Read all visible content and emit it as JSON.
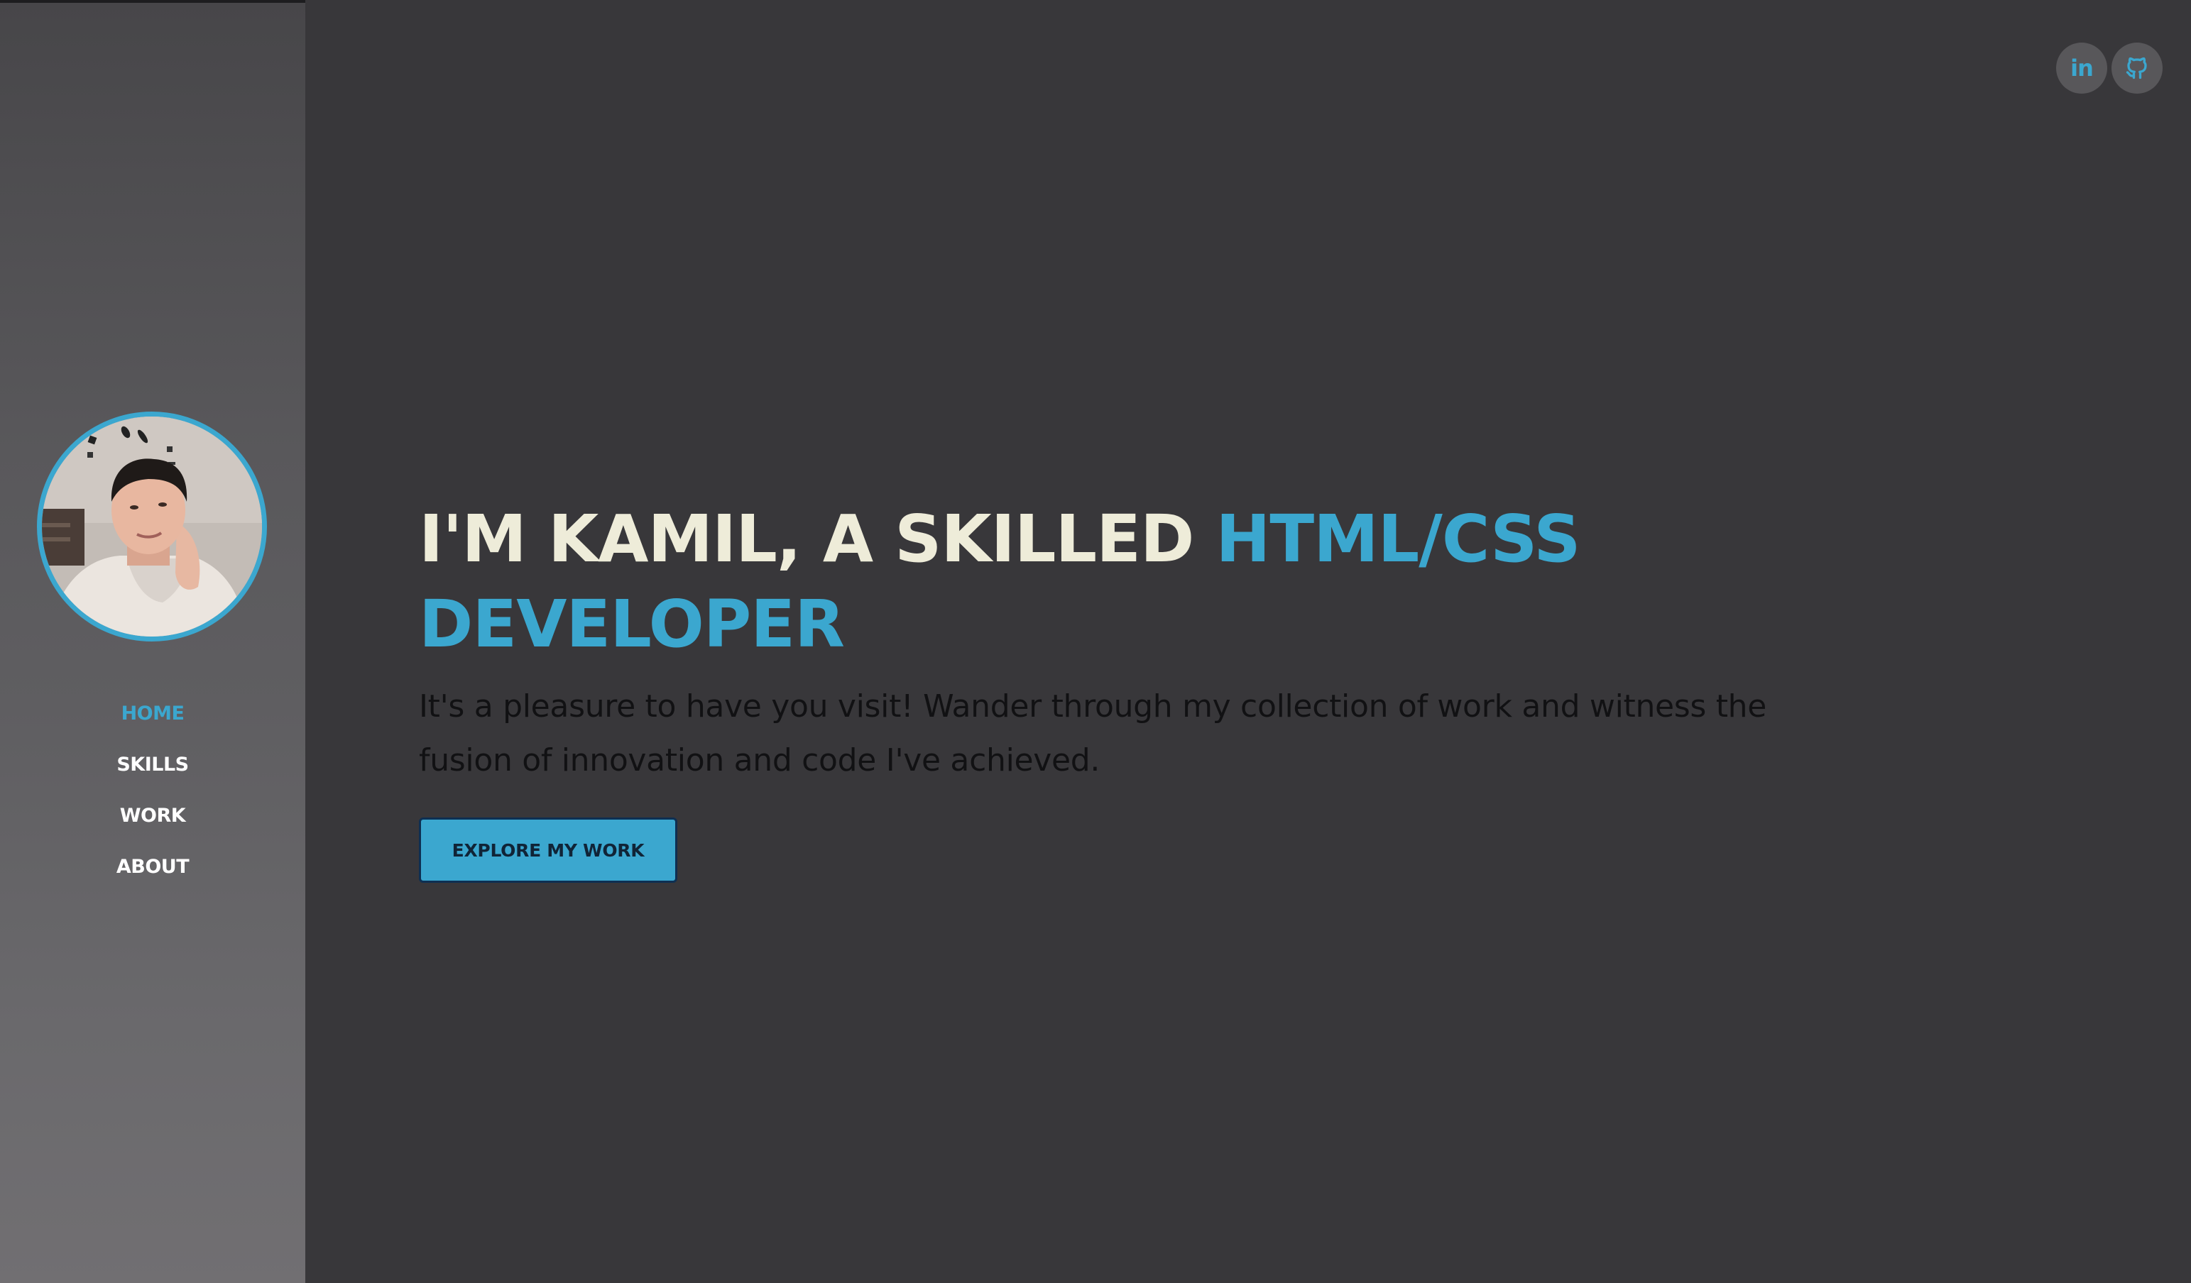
{
  "sidebar": {
    "nav": [
      {
        "label": "HOME",
        "active": true
      },
      {
        "label": "SKILLS",
        "active": false
      },
      {
        "label": "WORK",
        "active": false
      },
      {
        "label": "ABOUT",
        "active": false
      }
    ]
  },
  "social": {
    "linkedin_label": "in",
    "linkedin_icon": "linkedin-icon",
    "github_icon": "github-icon"
  },
  "hero": {
    "headline_part1": "I'M KAMIL, A SKILLED ",
    "headline_accent": "HTML/CSS DEVELOPER",
    "intro": "It's a pleasure to have you visit! Wander through my collection of work and witness the fusion of innovation and code I've achieved.",
    "cta_label": "EXPLORE MY WORK"
  },
  "colors": {
    "background": "#38373a",
    "accent": "#3ba7cf",
    "headline": "#eeecd9",
    "body_text": "#111113",
    "sidebar": "#5f5e61"
  }
}
